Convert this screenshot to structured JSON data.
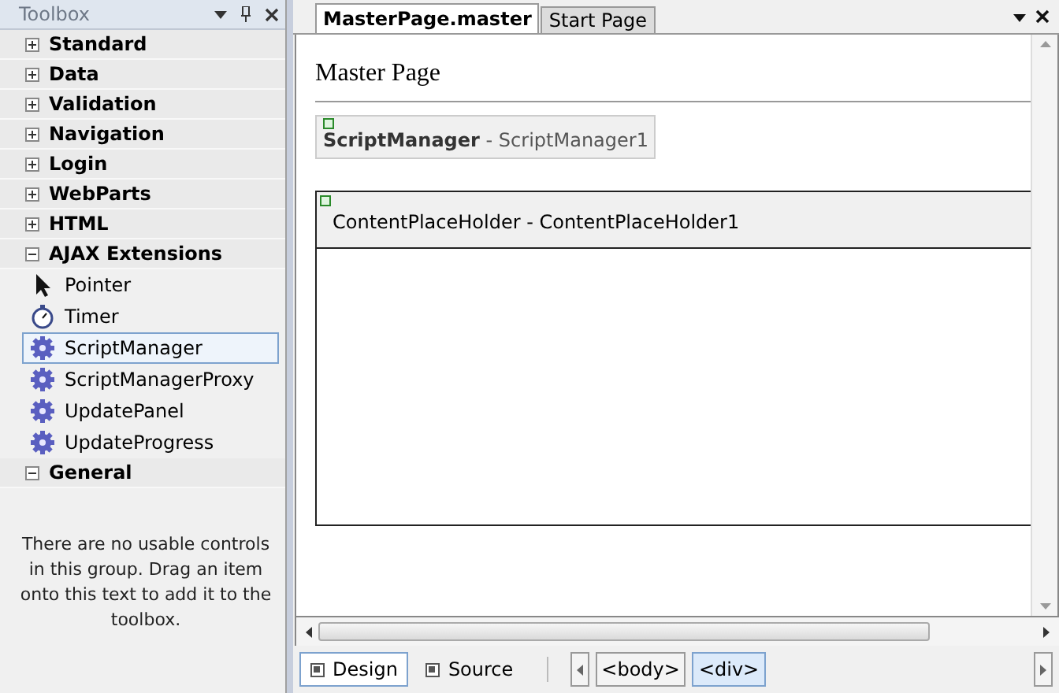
{
  "toolbox": {
    "title": "Toolbox",
    "groups": [
      {
        "label": "Standard",
        "expanded": false
      },
      {
        "label": "Data",
        "expanded": false
      },
      {
        "label": "Validation",
        "expanded": false
      },
      {
        "label": "Navigation",
        "expanded": false
      },
      {
        "label": "Login",
        "expanded": false
      },
      {
        "label": "WebParts",
        "expanded": false
      },
      {
        "label": "HTML",
        "expanded": false
      },
      {
        "label": "AJAX Extensions",
        "expanded": true,
        "items": [
          {
            "label": "Pointer",
            "kind": "pointer",
            "selected": false
          },
          {
            "label": "Timer",
            "kind": "timer",
            "selected": false
          },
          {
            "label": "ScriptManager",
            "kind": "gear",
            "selected": true
          },
          {
            "label": "ScriptManagerProxy",
            "kind": "gear",
            "selected": false
          },
          {
            "label": "UpdatePanel",
            "kind": "gear",
            "selected": false
          },
          {
            "label": "UpdateProgress",
            "kind": "gear",
            "selected": false
          }
        ]
      },
      {
        "label": "General",
        "expanded": true,
        "message": "There are no usable controls in this group. Drag an item onto this text to add it to the toolbox."
      }
    ]
  },
  "editor": {
    "tabs": [
      {
        "label": "MasterPage.master",
        "selected": true
      },
      {
        "label": "Start Page",
        "selected": false
      }
    ],
    "design": {
      "heading": "Master Page",
      "script_manager": {
        "type": "ScriptManager",
        "id": "- ScriptManager1"
      },
      "placeholder": "ContentPlaceHolder - ContentPlaceHolder1"
    },
    "views": [
      {
        "label": "Design",
        "selected": true
      },
      {
        "label": "Source",
        "selected": false
      }
    ],
    "breadcrumbs": [
      {
        "label": "<body>",
        "selected": false
      },
      {
        "label": "<div>",
        "selected": true
      }
    ]
  }
}
